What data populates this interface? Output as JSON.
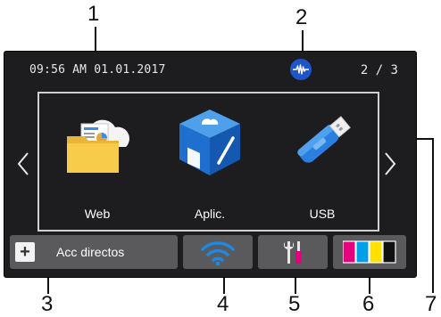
{
  "callouts": [
    "1",
    "2",
    "3",
    "4",
    "5",
    "6",
    "7"
  ],
  "status_bar": {
    "datetime": "09:56 AM  01.01.2017",
    "page_indicator": "2 / 3",
    "wifi_direct_icon": "wifi-direct-icon"
  },
  "apps": [
    {
      "label": "Web",
      "icon": "web-folder-cloud-icon"
    },
    {
      "label": "Aplic.",
      "icon": "apps-cube-icon"
    },
    {
      "label": "USB",
      "icon": "usb-drive-icon"
    }
  ],
  "bottom_bar": {
    "shortcuts_label": "Acc directos",
    "shortcuts_icon": "plus-icon",
    "wifi_icon": "wifi-icon",
    "settings_icon": "settings-tools-icon",
    "ink_icon": "ink-cartridges-icon"
  },
  "colors": {
    "screen_bg": "#1d1d1f",
    "button_bg": "#5a5a5c",
    "accent_blue": "#1e88e5",
    "wifi_direct_blue": "#1e56c9",
    "ink_magenta": "#e6007e",
    "ink_cyan": "#00a0e9",
    "ink_yellow": "#ffe100",
    "ink_black": "#111111"
  }
}
